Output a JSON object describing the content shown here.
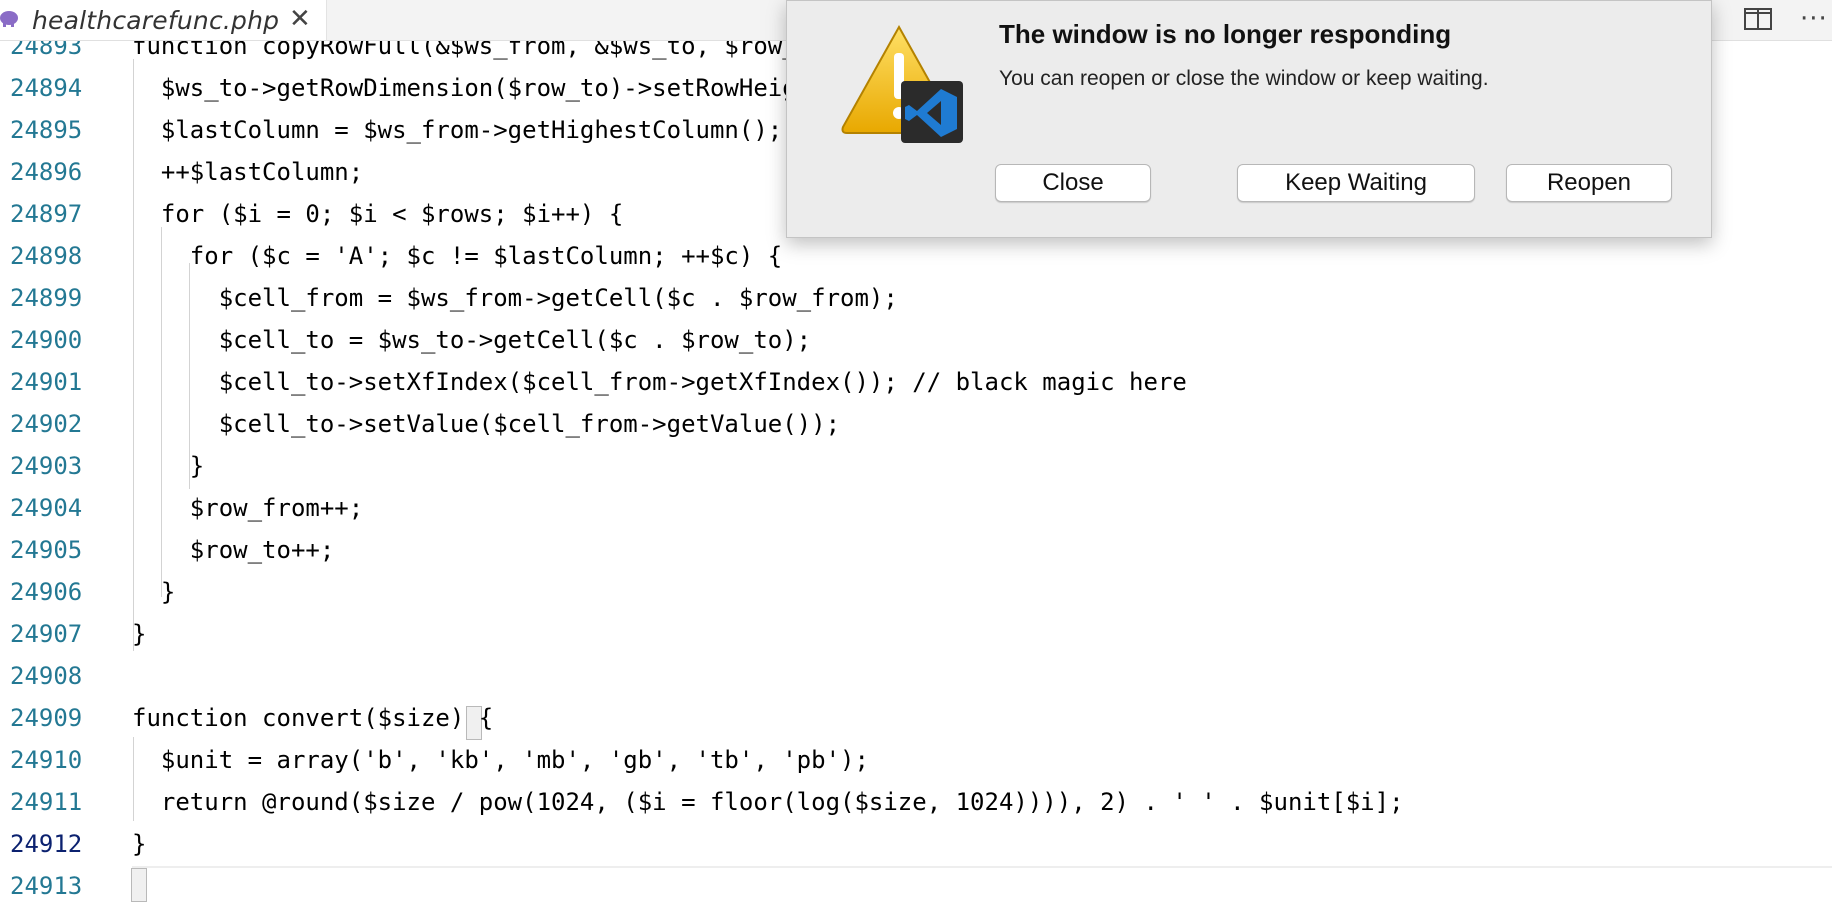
{
  "tab": {
    "title": "healthcarefunc.php",
    "close_glyph": "✕",
    "file_icon": "php-elephant-icon",
    "file_icon_color": "#8a6cc6"
  },
  "toolbar": {
    "split_icon": "split-editor-icon",
    "more_glyph": "···"
  },
  "editor": {
    "lines": [
      {
        "num": "24893",
        "text": "function copyRowFull(&$ws_from, &$ws_to, $row_f"
      },
      {
        "num": "24894",
        "text": "  $ws_to->getRowDimension($row_to)->setRowHeigh"
      },
      {
        "num": "24895",
        "text": "  $lastColumn = $ws_from->getHighestColumn();"
      },
      {
        "num": "24896",
        "text": "  ++$lastColumn;"
      },
      {
        "num": "24897",
        "text": "  for ($i = 0; $i < $rows; $i++) {"
      },
      {
        "num": "24898",
        "text": "    for ($c = 'A'; $c != $lastColumn; ++$c) {"
      },
      {
        "num": "24899",
        "text": "      $cell_from = $ws_from->getCell($c . $row_from);"
      },
      {
        "num": "24900",
        "text": "      $cell_to = $ws_to->getCell($c . $row_to);"
      },
      {
        "num": "24901",
        "text": "      $cell_to->setXfIndex($cell_from->getXfIndex()); // black magic here"
      },
      {
        "num": "24902",
        "text": "      $cell_to->setValue($cell_from->getValue());"
      },
      {
        "num": "24903",
        "text": "    }"
      },
      {
        "num": "24904",
        "text": "    $row_from++;"
      },
      {
        "num": "24905",
        "text": "    $row_to++;"
      },
      {
        "num": "24906",
        "text": "  }"
      },
      {
        "num": "24907",
        "text": "}"
      },
      {
        "num": "24908",
        "text": ""
      },
      {
        "num": "24909",
        "text": "function convert($size) {"
      },
      {
        "num": "24910",
        "text": "  $unit = array('b', 'kb', 'mb', 'gb', 'tb', 'pb');"
      },
      {
        "num": "24911",
        "text": "  return @round($size / pow(1024, ($i = floor(log($size, 1024)))), 2) . ' ' . $unit[$i];"
      },
      {
        "num": "24912",
        "text": "}"
      },
      {
        "num": "24913",
        "text": ""
      }
    ],
    "active_line": "24912"
  },
  "dialog": {
    "title": "The window is no longer responding",
    "message": "You can reopen or close the window or keep waiting.",
    "icon": "warning-vscode-icon",
    "buttons": {
      "close": "Close",
      "keep_waiting": "Keep Waiting",
      "reopen": "Reopen"
    }
  },
  "colors": {
    "line_number": "#237893",
    "active_line_number": "#0b216f",
    "warning_yellow": "#f5c400",
    "vscode_blue": "#1f7bd2"
  }
}
